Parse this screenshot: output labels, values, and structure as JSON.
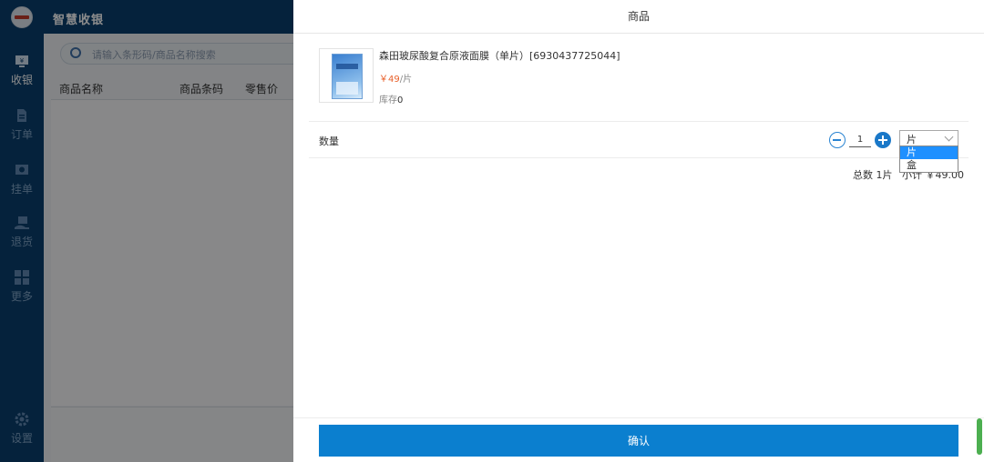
{
  "app": {
    "title": "智慧收银"
  },
  "sidebar": {
    "items": [
      {
        "label": "收银",
        "icon": "cashier-icon"
      },
      {
        "label": "订单",
        "icon": "order-icon"
      },
      {
        "label": "挂单",
        "icon": "hold-order-icon"
      },
      {
        "label": "退货",
        "icon": "return-icon"
      },
      {
        "label": "更多",
        "icon": "grid-icon"
      },
      {
        "label": "设置",
        "icon": "gear-icon"
      }
    ]
  },
  "main": {
    "search": {
      "placeholder": "请输入条形码/商品名称搜索"
    },
    "columns": [
      "商品名称",
      "商品条码",
      "零售价"
    ]
  },
  "dialog": {
    "title": "商品",
    "product": {
      "name": "森田玻尿酸复合原液面膜（单片）[6930437725044]",
      "price": "￥49",
      "price_unit": "/片",
      "stock_label": "库存",
      "stock_value": "0"
    },
    "quantity": {
      "label": "数量",
      "value": "1",
      "unit_selected": "片",
      "unit_options": [
        "片",
        "盒"
      ]
    },
    "summary": {
      "total": "总数 1片",
      "subtotal": "小计 ￥49.00"
    },
    "confirm_label": "确认"
  },
  "colors": {
    "nav_bg": "#0a3f6e",
    "accent": "#0b7fcf",
    "price": "#e8612c"
  }
}
